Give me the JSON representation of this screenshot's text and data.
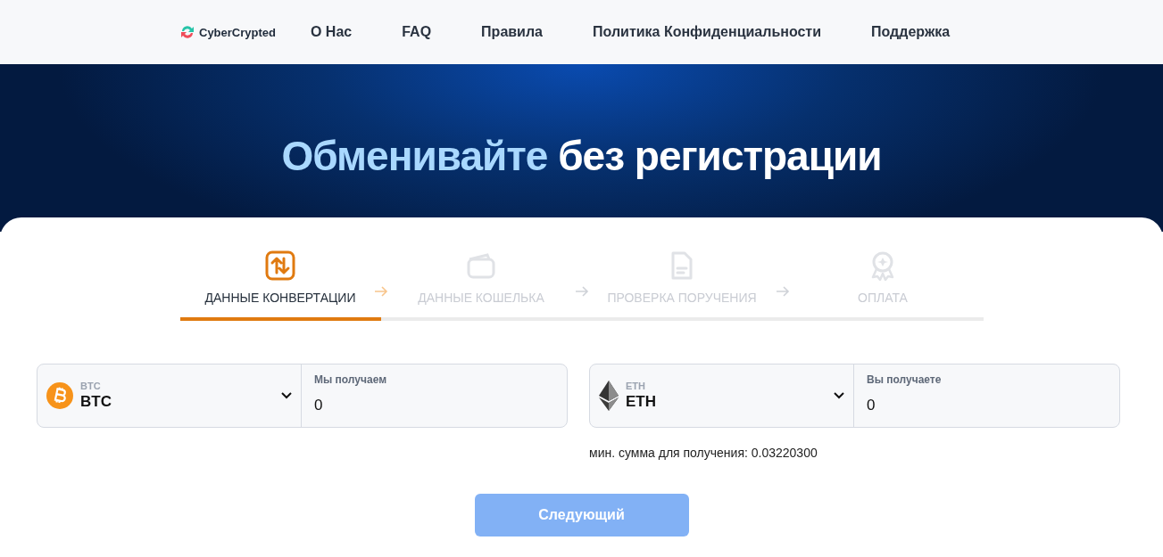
{
  "header": {
    "logo": "CyberCrypted",
    "nav": [
      "О Нас",
      "FAQ",
      "Правила",
      "Политика Конфиденциальности",
      "Поддержка"
    ]
  },
  "hero": {
    "title_highlight": "Обменивайте",
    "title_rest": "без регистрации"
  },
  "steps": [
    {
      "label": "ДАННЫЕ КОНВЕРТАЦИИ",
      "kind": "convert",
      "selected": true
    },
    {
      "label": "ДАННЫЕ КОШЕЛЬКА",
      "kind": "wallet",
      "selected": false
    },
    {
      "label": "ПРОВЕРКА ПОРУЧЕНИЯ",
      "kind": "document",
      "selected": false
    },
    {
      "label": "ОПЛАТА",
      "kind": "award",
      "selected": false
    }
  ],
  "exchange": [
    {
      "kind": "btc",
      "caption": "BTC",
      "value": "BTC",
      "amount_label": "Мы получаем",
      "amount": "0"
    },
    {
      "kind": "eth",
      "caption": "ETH",
      "value": "ETH",
      "amount_label": "Вы получаете",
      "amount": "0",
      "note": "мин. сумма для получения: 0.03220300"
    }
  ],
  "next_button": {
    "label": "Следующий",
    "disabled": true
  }
}
